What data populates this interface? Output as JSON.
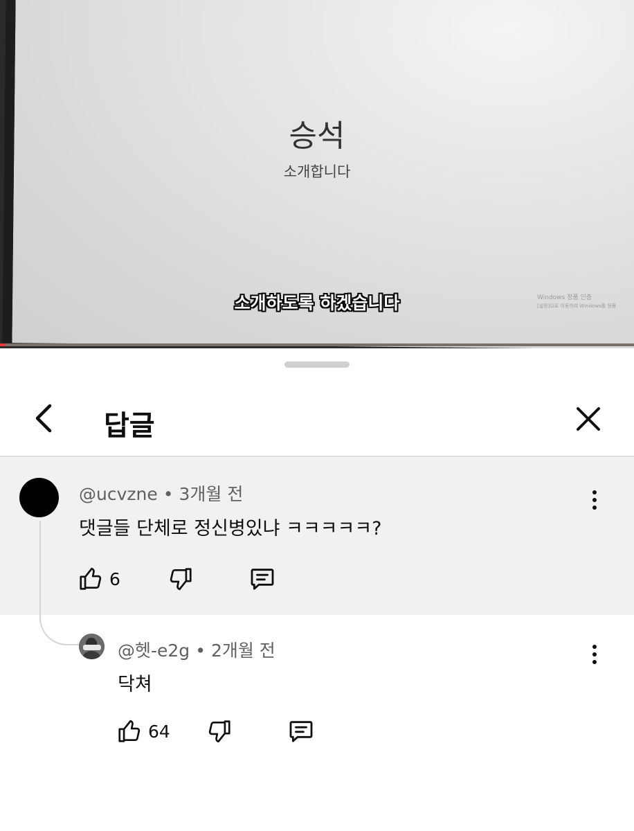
{
  "video": {
    "title": "승석",
    "subtitle": "소개합니다",
    "caption": "소개하도록 하겠습니다",
    "watermark_line1": "Windows 정품 인증",
    "watermark_line2": "[설정]으로 이동하여 Windows를 정품"
  },
  "sheet": {
    "title": "답글"
  },
  "parent_comment": {
    "author": "@ucvzne",
    "separator": "•",
    "time": "3개월 전",
    "text": "댓글들 단체로 정신병있냐 ㅋㅋㅋㅋㅋ?",
    "likes": "6"
  },
  "reply": {
    "author": "@헷-e2g",
    "separator": "•",
    "time": "2개월 전",
    "text": "닥쳐",
    "likes": "64"
  },
  "colors": {
    "caption_text": "#ffffff",
    "caption_outline": "#000000",
    "progress_played": "#e53935",
    "parent_bg": "#f1f1f1",
    "meta_text": "#606060"
  },
  "icons": [
    "back-arrow-icon",
    "close-icon",
    "more-vert-icon",
    "thumb-up-icon",
    "thumb-down-icon",
    "reply-comment-icon"
  ]
}
